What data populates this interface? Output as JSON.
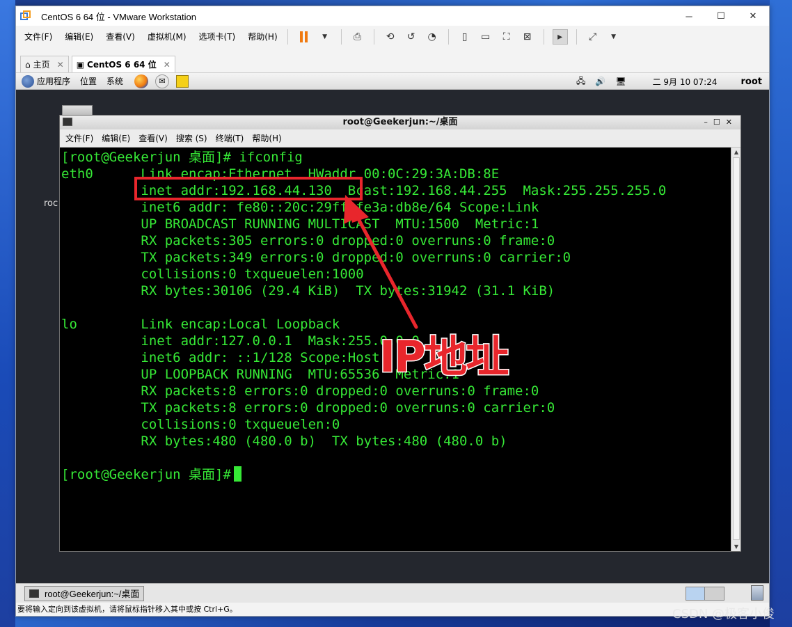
{
  "window": {
    "title": "CentOS 6 64 位 - VMware Workstation",
    "min": "─",
    "max": "☐",
    "close": "✕"
  },
  "menu": [
    "文件(F)",
    "编辑(E)",
    "查看(V)",
    "虚拟机(M)",
    "选项卡(T)",
    "帮助(H)"
  ],
  "tabs": [
    {
      "label": "主页",
      "icon": "home-icon"
    },
    {
      "label": "CentOS 6 64 位",
      "icon": "vm-icon"
    }
  ],
  "gnome_panel": {
    "apps": "应用程序",
    "places": "位置",
    "system": "系统",
    "clock": "二 9月 10 07:24",
    "user": "root"
  },
  "desktop": {
    "label": "roc"
  },
  "terminal": {
    "title": "root@Geekerjun:~/桌面",
    "menu": [
      "文件(F)",
      "编辑(E)",
      "查看(V)",
      "搜索 (S)",
      "终端(T)",
      "帮助(H)"
    ],
    "lines": [
      "[root@Geekerjun 桌面]# ifconfig",
      "eth0      Link encap:Ethernet  HWaddr 00:0C:29:3A:DB:8E",
      "          inet addr:192.168.44.130  Bcast:192.168.44.255  Mask:255.255.255.0",
      "          inet6 addr: fe80::20c:29ff:fe3a:db8e/64 Scope:Link",
      "          UP BROADCAST RUNNING MULTICAST  MTU:1500  Metric:1",
      "          RX packets:305 errors:0 dropped:0 overruns:0 frame:0",
      "          TX packets:349 errors:0 dropped:0 overruns:0 carrier:0",
      "          collisions:0 txqueuelen:1000",
      "          RX bytes:30106 (29.4 KiB)  TX bytes:31942 (31.1 KiB)",
      "",
      "lo        Link encap:Local Loopback",
      "          inet addr:127.0.0.1  Mask:255.0.0.0",
      "          inet6 addr: ::1/128 Scope:Host",
      "          UP LOOPBACK RUNNING  MTU:65536  Metric:1",
      "          RX packets:8 errors:0 dropped:0 overruns:0 frame:0",
      "          TX packets:8 errors:0 dropped:0 overruns:0 carrier:0",
      "          collisions:0 txqueuelen:0",
      "          RX bytes:480 (480.0 b)  TX bytes:480 (480.0 b)",
      ""
    ],
    "prompt": "[root@Geekerjun 桌面]#"
  },
  "annotation": {
    "label": "IP地址",
    "color": "#e8262c"
  },
  "taskbar": {
    "item": "root@Geekerjun:~/桌面"
  },
  "status": "要将输入定向到该虚拟机，请将鼠标指针移入其中或按 Ctrl+G。",
  "watermark": "CSDN @极客小俊"
}
